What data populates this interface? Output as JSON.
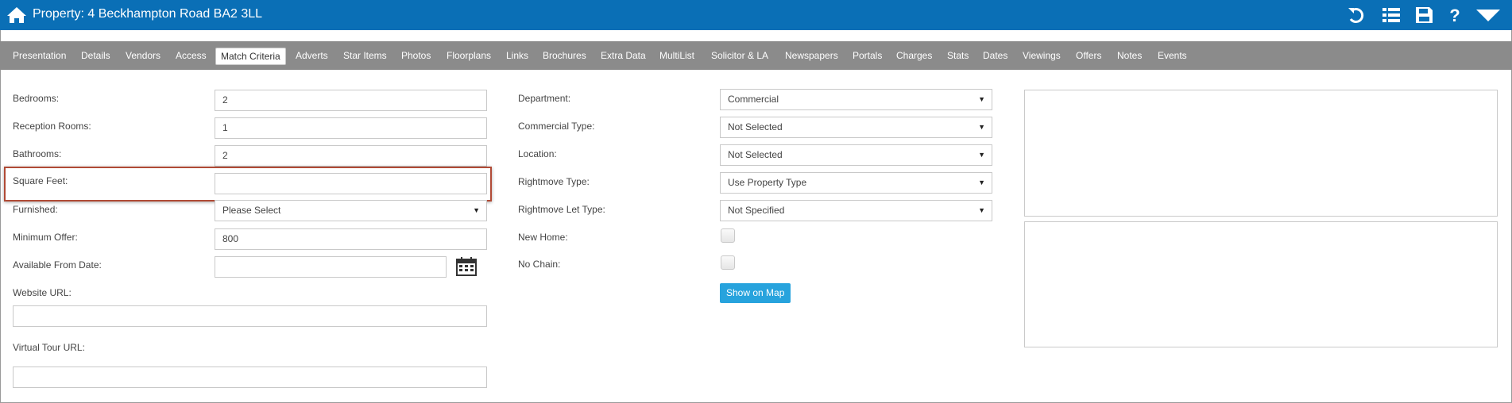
{
  "title": "Property: 4 Beckhampton Road BA2 3LL",
  "toolbar_icons": [
    "undo-icon",
    "list-icon",
    "save-icon",
    "help-icon",
    "dropdown-menu-icon"
  ],
  "tabs": [
    "Presentation",
    "Details",
    "Vendors",
    "Access",
    "Match Criteria",
    "Adverts",
    "Star Items",
    "Photos",
    "Floorplans",
    "Links",
    "Brochures",
    "Extra Data",
    "MultiList",
    "Solicitor & LA",
    "Newspapers",
    "Portals",
    "Charges",
    "Stats",
    "Dates",
    "Viewings",
    "Offers",
    "Notes",
    "Events"
  ],
  "active_tab": "Match Criteria",
  "left": {
    "bedrooms_label": "Bedrooms:",
    "bedrooms_value": "2",
    "reception_label": "Reception Rooms:",
    "reception_value": "1",
    "bathrooms_label": "Bathrooms:",
    "bathrooms_value": "2",
    "square_feet_label": "Square Feet:",
    "square_feet_value": "",
    "furnished_label": "Furnished:",
    "furnished_value": "Please Select",
    "min_offer_label": "Minimum Offer:",
    "min_offer_value": "800",
    "available_label": "Available From Date:",
    "available_value": "",
    "website_label": "Website URL:",
    "website_value": "",
    "virtual_tour_label": "Virtual Tour URL:",
    "virtual_tour_value": ""
  },
  "middle": {
    "department_label": "Department:",
    "department_value": "Commercial",
    "commercial_type_label": "Commercial Type:",
    "commercial_type_value": "Not Selected",
    "location_label": "Location:",
    "location_value": "Not Selected",
    "rightmove_type_label": "Rightmove Type:",
    "rightmove_type_value": "Use Property Type",
    "rightmove_let_label": "Rightmove Let Type:",
    "rightmove_let_value": "Not Specified",
    "new_home_label": "New Home:",
    "new_home_checked": false,
    "no_chain_label": "No Chain:",
    "no_chain_checked": false,
    "show_on_map_label": "Show on Map"
  },
  "colors": {
    "titlebar": "#0a6fb6",
    "tabbar": "#8b8b8b",
    "button": "#27a3dd",
    "highlight": "#b04a35"
  }
}
